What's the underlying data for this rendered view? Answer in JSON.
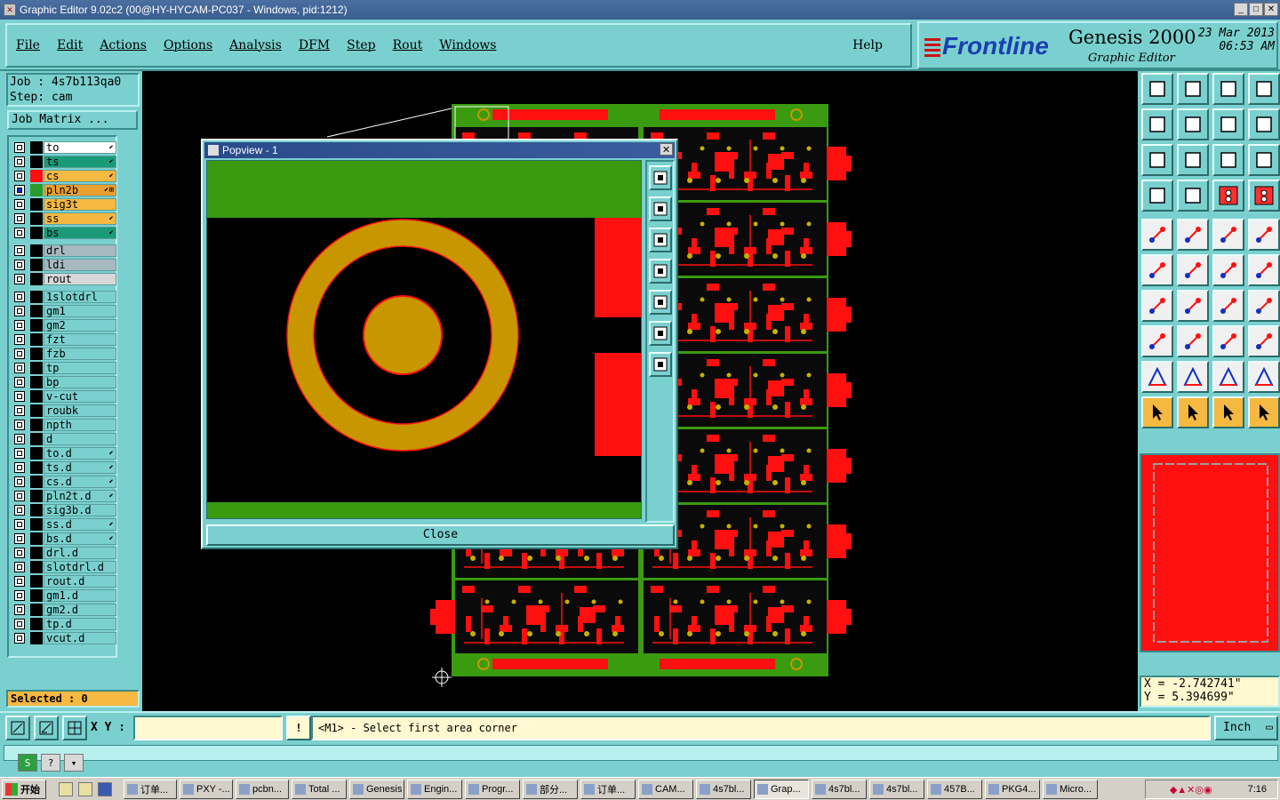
{
  "window": {
    "title": "Graphic Editor 9.02c2 (00@HY-HYCAM-PC037 - Windows, pid:1212)"
  },
  "menu": {
    "items": [
      "File",
      "Edit",
      "Actions",
      "Options",
      "Analysis",
      "DFM",
      "Step",
      "Rout",
      "Windows"
    ],
    "help": "Help"
  },
  "brand": {
    "logo": "Frontline",
    "product": "Genesis 2000",
    "subtitle": "Graphic Editor",
    "date": "23 Mar 2013",
    "time": "06:53 AM"
  },
  "job": {
    "job_line": "Job : 4s7b113qa0",
    "step_line": "Step: cam",
    "matrix_button": "Job Matrix ..."
  },
  "layers": [
    {
      "name": "to",
      "color": "#ffffff",
      "swatch": "#000000",
      "mark": "⬋",
      "group": 0
    },
    {
      "name": "ts",
      "color": "#1a9a78",
      "swatch": "#000000",
      "mark": "⬋",
      "group": 0
    },
    {
      "name": "cs",
      "color": "#f5b840",
      "swatch": "#ff1010",
      "mark": "⬋",
      "group": 0
    },
    {
      "name": "pln2b",
      "color": "#e8a030",
      "swatch": "#2a9a2a",
      "mark": "⬋⊞",
      "group": 0,
      "active": true
    },
    {
      "name": "sig3t",
      "color": "#f5b840",
      "swatch": "#000000",
      "mark": "",
      "group": 0
    },
    {
      "name": "ss",
      "color": "#f5b840",
      "swatch": "#000000",
      "mark": "⬋",
      "group": 0
    },
    {
      "name": "bs",
      "color": "#1a9a78",
      "swatch": "#000000",
      "mark": "⬋",
      "group": 0
    },
    {
      "name": "drl",
      "color": "#a8b8c0",
      "swatch": "#000000",
      "mark": "",
      "group": 1
    },
    {
      "name": "ldi",
      "color": "#a8b8c0",
      "swatch": "#000000",
      "mark": "",
      "group": 1
    },
    {
      "name": "rout",
      "color": "#d8d8d8",
      "swatch": "#000000",
      "mark": "",
      "group": 1
    },
    {
      "name": "1slotdrl",
      "color": "#7ad0cf",
      "swatch": "#000000",
      "mark": "",
      "group": 2
    },
    {
      "name": "gm1",
      "color": "#7ad0cf",
      "swatch": "#000000",
      "mark": "",
      "group": 2
    },
    {
      "name": "gm2",
      "color": "#7ad0cf",
      "swatch": "#000000",
      "mark": "",
      "group": 2
    },
    {
      "name": "fzt",
      "color": "#7ad0cf",
      "swatch": "#000000",
      "mark": "",
      "group": 2
    },
    {
      "name": "fzb",
      "color": "#7ad0cf",
      "swatch": "#000000",
      "mark": "",
      "group": 2
    },
    {
      "name": "tp",
      "color": "#7ad0cf",
      "swatch": "#000000",
      "mark": "",
      "group": 2
    },
    {
      "name": "bp",
      "color": "#7ad0cf",
      "swatch": "#000000",
      "mark": "",
      "group": 2
    },
    {
      "name": "v-cut",
      "color": "#7ad0cf",
      "swatch": "#000000",
      "mark": "",
      "group": 2
    },
    {
      "name": "roubk",
      "color": "#7ad0cf",
      "swatch": "#000000",
      "mark": "",
      "group": 2
    },
    {
      "name": "npth",
      "color": "#7ad0cf",
      "swatch": "#000000",
      "mark": "",
      "group": 2
    },
    {
      "name": "d",
      "color": "#7ad0cf",
      "swatch": "#000000",
      "mark": "",
      "group": 2
    },
    {
      "name": "to.d",
      "color": "#7ad0cf",
      "swatch": "#000000",
      "mark": "⬋",
      "group": 2
    },
    {
      "name": "ts.d",
      "color": "#7ad0cf",
      "swatch": "#000000",
      "mark": "⬋",
      "group": 2
    },
    {
      "name": "cs.d",
      "color": "#7ad0cf",
      "swatch": "#000000",
      "mark": "⬋",
      "group": 2
    },
    {
      "name": "pln2t.d",
      "color": "#7ad0cf",
      "swatch": "#000000",
      "mark": "⬋",
      "group": 2
    },
    {
      "name": "sig3b.d",
      "color": "#7ad0cf",
      "swatch": "#000000",
      "mark": "",
      "group": 2
    },
    {
      "name": "ss.d",
      "color": "#7ad0cf",
      "swatch": "#000000",
      "mark": "⬋",
      "group": 2
    },
    {
      "name": "bs.d",
      "color": "#7ad0cf",
      "swatch": "#000000",
      "mark": "⬋",
      "group": 2
    },
    {
      "name": "drl.d",
      "color": "#7ad0cf",
      "swatch": "#000000",
      "mark": "",
      "group": 2
    },
    {
      "name": "slotdrl.d",
      "color": "#7ad0cf",
      "swatch": "#000000",
      "mark": "",
      "group": 2
    },
    {
      "name": "rout.d",
      "color": "#7ad0cf",
      "swatch": "#000000",
      "mark": "",
      "group": 2
    },
    {
      "name": "gm1.d",
      "color": "#7ad0cf",
      "swatch": "#000000",
      "mark": "",
      "group": 2
    },
    {
      "name": "gm2.d",
      "color": "#7ad0cf",
      "swatch": "#000000",
      "mark": "",
      "group": 2
    },
    {
      "name": "tp.d",
      "color": "#7ad0cf",
      "swatch": "#000000",
      "mark": "",
      "group": 2
    },
    {
      "name": "vcut.d",
      "color": "#7ad0cf",
      "swatch": "#000000",
      "mark": "",
      "group": 2
    }
  ],
  "selected": "Selected : 0",
  "popview": {
    "title": "Popview - 1",
    "close_label": "Close"
  },
  "coords": {
    "x": "X  = -2.742741\"",
    "y": "Y  = 5.394699\""
  },
  "bottom": {
    "xy_label": "X Y :",
    "xy_value": "",
    "message": "<M1> - Select first area corner",
    "units": "Inch"
  },
  "taskbar": {
    "start": "开始",
    "tasks": [
      "订单...",
      "PXY -...",
      "pcbn...",
      "Total ...",
      "Genesis",
      "Engin...",
      "Progr...",
      "部分...",
      "订单...",
      "CAM...",
      "4s7bl...",
      "Grap...",
      "4s7bl...",
      "4s7bl...",
      "457B...",
      "PKG4...",
      "Micro..."
    ],
    "active_index": 11,
    "clock": "7:16"
  },
  "colors": {
    "panel": "#7ad0cf",
    "copper": "#ff1010",
    "pad": "#c89600",
    "mask": "#3a9a10"
  }
}
